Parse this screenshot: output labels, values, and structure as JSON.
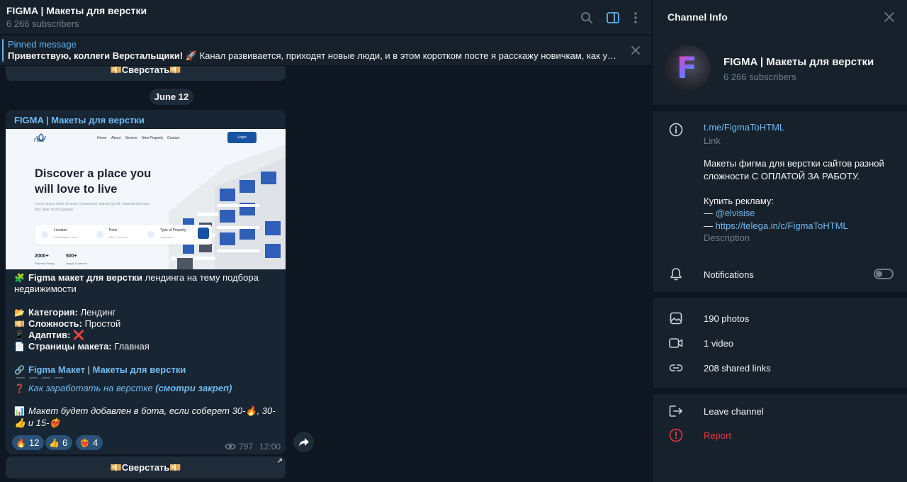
{
  "colors": {
    "background": "#0e1621",
    "header": "#17212b",
    "bubble": "#182533",
    "accent": "#71baf2",
    "reaction": "#2b5278",
    "danger": "#e5393e"
  },
  "chat": {
    "title": "FIGMA | Макеты для верстки",
    "subscribers": "6 266 subscribers",
    "header_icons": [
      "search-icon",
      "sidebar-toggle-icon",
      "more-vertical-icon"
    ]
  },
  "pinned": {
    "label": "Pinned message",
    "bold_part": "Приветствую, коллеги Верстальщики!",
    "emoji": "🚀",
    "rest": " Канал развивается, приходят новые люди, и в этом коротком посте я расскажу новичкам, как устроен..."
  },
  "top_inline_button": "💴Сверстать💴",
  "date_chip": "June 12",
  "post": {
    "author": "FIGMA | Макеты для верстки",
    "preview": {
      "logo": "Flora",
      "nav": [
        "Home",
        "About",
        "Service",
        "New Property",
        "Contact"
      ],
      "login": "Login",
      "headline": "Discover a place you will love to live",
      "paragraph": "Lorem ipsum dolor sit amet, consectetur adipiscing elit. Imperdiet tempus felis vitae sit est quisque.",
      "fields": [
        {
          "title": "Location",
          "sub": "Ahmedabad, India"
        },
        {
          "title": "Price",
          "sub": "$xxx - $xx,xxx"
        },
        {
          "title": "Type of Property",
          "sub": "Apartment"
        }
      ],
      "stats": [
        {
          "value": "2000+",
          "label": "Property Ready"
        },
        {
          "value": "500+",
          "label": "Happy Customer"
        }
      ]
    },
    "intro_emoji": "🧩",
    "intro_bold": "Figma макет для верстки",
    "intro_rest": " лендинга на тему подбора",
    "intro_line2": "недвижимости",
    "props": [
      {
        "emoji": "📂",
        "label": "Категория:",
        "value": " Лендинг"
      },
      {
        "emoji": "💴",
        "label": "Сложность:",
        "value": " Простой"
      },
      {
        "emoji": "📱",
        "label": "Адаптив:",
        "value": " ❌"
      },
      {
        "emoji": "📄",
        "label": "Страницы макета:",
        "value": " Главная"
      }
    ],
    "link_emoji": "🔗",
    "link_a": "Figma Макет",
    "link_sep": " | ",
    "link_b": "Макеты для верстки",
    "earn_emoji": "❓",
    "earn_text": "Как заработать на верстке",
    "earn_link": "(смотри закреп)",
    "bot_emoji": "📊",
    "bot_text": "Макет будет добавлен в бота, если соберет 30-🔥, 30-👍 и 15-❤‍🔥",
    "reactions": [
      {
        "emoji": "🔥",
        "count": "12"
      },
      {
        "emoji": "👍",
        "count": "6"
      },
      {
        "emoji": "❤‍🔥",
        "count": "4"
      }
    ],
    "views": "797",
    "time": "12:00",
    "inline_button": "💴Сверстать💴",
    "inline_button_corner": "↗"
  },
  "panel": {
    "title": "Channel Info",
    "channel_name": "FIGMA | Макеты для верстки",
    "channel_subs": "6 266 subscribers",
    "avatar_letter": "F",
    "link": "t.me/FigmaToHTML",
    "link_caption": "Link",
    "desc_line1": "Макеты фигма для верстки сайтов разной",
    "desc_line2": "сложности С ОПЛАТОЙ ЗА РАБОТУ.",
    "desc_line3": "Купить рекламу:",
    "desc_dash": " — ",
    "desc_contact": "@elvisise",
    "desc_url": "https://telega.in/c/FigmaToHTML",
    "desc_caption": "Description",
    "notifications": "Notifications",
    "notifications_on": false,
    "photos": "190 photos",
    "video": "1 video",
    "links": "208 shared links",
    "leave": "Leave channel",
    "report": "Report"
  }
}
